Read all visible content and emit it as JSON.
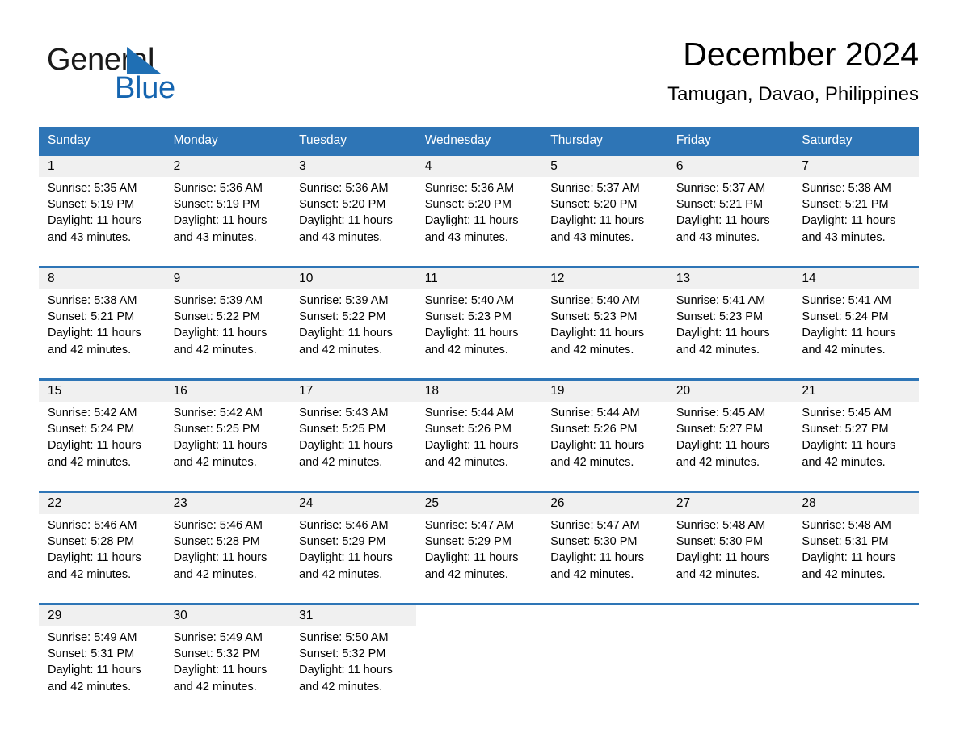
{
  "brand": {
    "name_top": "General",
    "name_bottom": "Blue",
    "accent_color": "#1565b0",
    "triangle_color": "#1f6fb4"
  },
  "header": {
    "title": "December 2024",
    "subtitle": "Tamugan, Davao, Philippines"
  },
  "theme": {
    "header_bg": "#2e75b6",
    "header_text": "#ffffff",
    "daynum_bg": "#f0f0f0",
    "row_rule": "#2e75b6",
    "page_bg": "#ffffff"
  },
  "weekdays": [
    "Sunday",
    "Monday",
    "Tuesday",
    "Wednesday",
    "Thursday",
    "Friday",
    "Saturday"
  ],
  "weeks": [
    [
      {
        "day": "1",
        "sunrise": "Sunrise: 5:35 AM",
        "sunset": "Sunset: 5:19 PM",
        "daylight": "Daylight: 11 hours and 43 minutes."
      },
      {
        "day": "2",
        "sunrise": "Sunrise: 5:36 AM",
        "sunset": "Sunset: 5:19 PM",
        "daylight": "Daylight: 11 hours and 43 minutes."
      },
      {
        "day": "3",
        "sunrise": "Sunrise: 5:36 AM",
        "sunset": "Sunset: 5:20 PM",
        "daylight": "Daylight: 11 hours and 43 minutes."
      },
      {
        "day": "4",
        "sunrise": "Sunrise: 5:36 AM",
        "sunset": "Sunset: 5:20 PM",
        "daylight": "Daylight: 11 hours and 43 minutes."
      },
      {
        "day": "5",
        "sunrise": "Sunrise: 5:37 AM",
        "sunset": "Sunset: 5:20 PM",
        "daylight": "Daylight: 11 hours and 43 minutes."
      },
      {
        "day": "6",
        "sunrise": "Sunrise: 5:37 AM",
        "sunset": "Sunset: 5:21 PM",
        "daylight": "Daylight: 11 hours and 43 minutes."
      },
      {
        "day": "7",
        "sunrise": "Sunrise: 5:38 AM",
        "sunset": "Sunset: 5:21 PM",
        "daylight": "Daylight: 11 hours and 43 minutes."
      }
    ],
    [
      {
        "day": "8",
        "sunrise": "Sunrise: 5:38 AM",
        "sunset": "Sunset: 5:21 PM",
        "daylight": "Daylight: 11 hours and 42 minutes."
      },
      {
        "day": "9",
        "sunrise": "Sunrise: 5:39 AM",
        "sunset": "Sunset: 5:22 PM",
        "daylight": "Daylight: 11 hours and 42 minutes."
      },
      {
        "day": "10",
        "sunrise": "Sunrise: 5:39 AM",
        "sunset": "Sunset: 5:22 PM",
        "daylight": "Daylight: 11 hours and 42 minutes."
      },
      {
        "day": "11",
        "sunrise": "Sunrise: 5:40 AM",
        "sunset": "Sunset: 5:23 PM",
        "daylight": "Daylight: 11 hours and 42 minutes."
      },
      {
        "day": "12",
        "sunrise": "Sunrise: 5:40 AM",
        "sunset": "Sunset: 5:23 PM",
        "daylight": "Daylight: 11 hours and 42 minutes."
      },
      {
        "day": "13",
        "sunrise": "Sunrise: 5:41 AM",
        "sunset": "Sunset: 5:23 PM",
        "daylight": "Daylight: 11 hours and 42 minutes."
      },
      {
        "day": "14",
        "sunrise": "Sunrise: 5:41 AM",
        "sunset": "Sunset: 5:24 PM",
        "daylight": "Daylight: 11 hours and 42 minutes."
      }
    ],
    [
      {
        "day": "15",
        "sunrise": "Sunrise: 5:42 AM",
        "sunset": "Sunset: 5:24 PM",
        "daylight": "Daylight: 11 hours and 42 minutes."
      },
      {
        "day": "16",
        "sunrise": "Sunrise: 5:42 AM",
        "sunset": "Sunset: 5:25 PM",
        "daylight": "Daylight: 11 hours and 42 minutes."
      },
      {
        "day": "17",
        "sunrise": "Sunrise: 5:43 AM",
        "sunset": "Sunset: 5:25 PM",
        "daylight": "Daylight: 11 hours and 42 minutes."
      },
      {
        "day": "18",
        "sunrise": "Sunrise: 5:44 AM",
        "sunset": "Sunset: 5:26 PM",
        "daylight": "Daylight: 11 hours and 42 minutes."
      },
      {
        "day": "19",
        "sunrise": "Sunrise: 5:44 AM",
        "sunset": "Sunset: 5:26 PM",
        "daylight": "Daylight: 11 hours and 42 minutes."
      },
      {
        "day": "20",
        "sunrise": "Sunrise: 5:45 AM",
        "sunset": "Sunset: 5:27 PM",
        "daylight": "Daylight: 11 hours and 42 minutes."
      },
      {
        "day": "21",
        "sunrise": "Sunrise: 5:45 AM",
        "sunset": "Sunset: 5:27 PM",
        "daylight": "Daylight: 11 hours and 42 minutes."
      }
    ],
    [
      {
        "day": "22",
        "sunrise": "Sunrise: 5:46 AM",
        "sunset": "Sunset: 5:28 PM",
        "daylight": "Daylight: 11 hours and 42 minutes."
      },
      {
        "day": "23",
        "sunrise": "Sunrise: 5:46 AM",
        "sunset": "Sunset: 5:28 PM",
        "daylight": "Daylight: 11 hours and 42 minutes."
      },
      {
        "day": "24",
        "sunrise": "Sunrise: 5:46 AM",
        "sunset": "Sunset: 5:29 PM",
        "daylight": "Daylight: 11 hours and 42 minutes."
      },
      {
        "day": "25",
        "sunrise": "Sunrise: 5:47 AM",
        "sunset": "Sunset: 5:29 PM",
        "daylight": "Daylight: 11 hours and 42 minutes."
      },
      {
        "day": "26",
        "sunrise": "Sunrise: 5:47 AM",
        "sunset": "Sunset: 5:30 PM",
        "daylight": "Daylight: 11 hours and 42 minutes."
      },
      {
        "day": "27",
        "sunrise": "Sunrise: 5:48 AM",
        "sunset": "Sunset: 5:30 PM",
        "daylight": "Daylight: 11 hours and 42 minutes."
      },
      {
        "day": "28",
        "sunrise": "Sunrise: 5:48 AM",
        "sunset": "Sunset: 5:31 PM",
        "daylight": "Daylight: 11 hours and 42 minutes."
      }
    ],
    [
      {
        "day": "29",
        "sunrise": "Sunrise: 5:49 AM",
        "sunset": "Sunset: 5:31 PM",
        "daylight": "Daylight: 11 hours and 42 minutes."
      },
      {
        "day": "30",
        "sunrise": "Sunrise: 5:49 AM",
        "sunset": "Sunset: 5:32 PM",
        "daylight": "Daylight: 11 hours and 42 minutes."
      },
      {
        "day": "31",
        "sunrise": "Sunrise: 5:50 AM",
        "sunset": "Sunset: 5:32 PM",
        "daylight": "Daylight: 11 hours and 42 minutes."
      },
      {
        "day": "",
        "sunrise": "",
        "sunset": "",
        "daylight": ""
      },
      {
        "day": "",
        "sunrise": "",
        "sunset": "",
        "daylight": ""
      },
      {
        "day": "",
        "sunrise": "",
        "sunset": "",
        "daylight": ""
      },
      {
        "day": "",
        "sunrise": "",
        "sunset": "",
        "daylight": ""
      }
    ]
  ]
}
